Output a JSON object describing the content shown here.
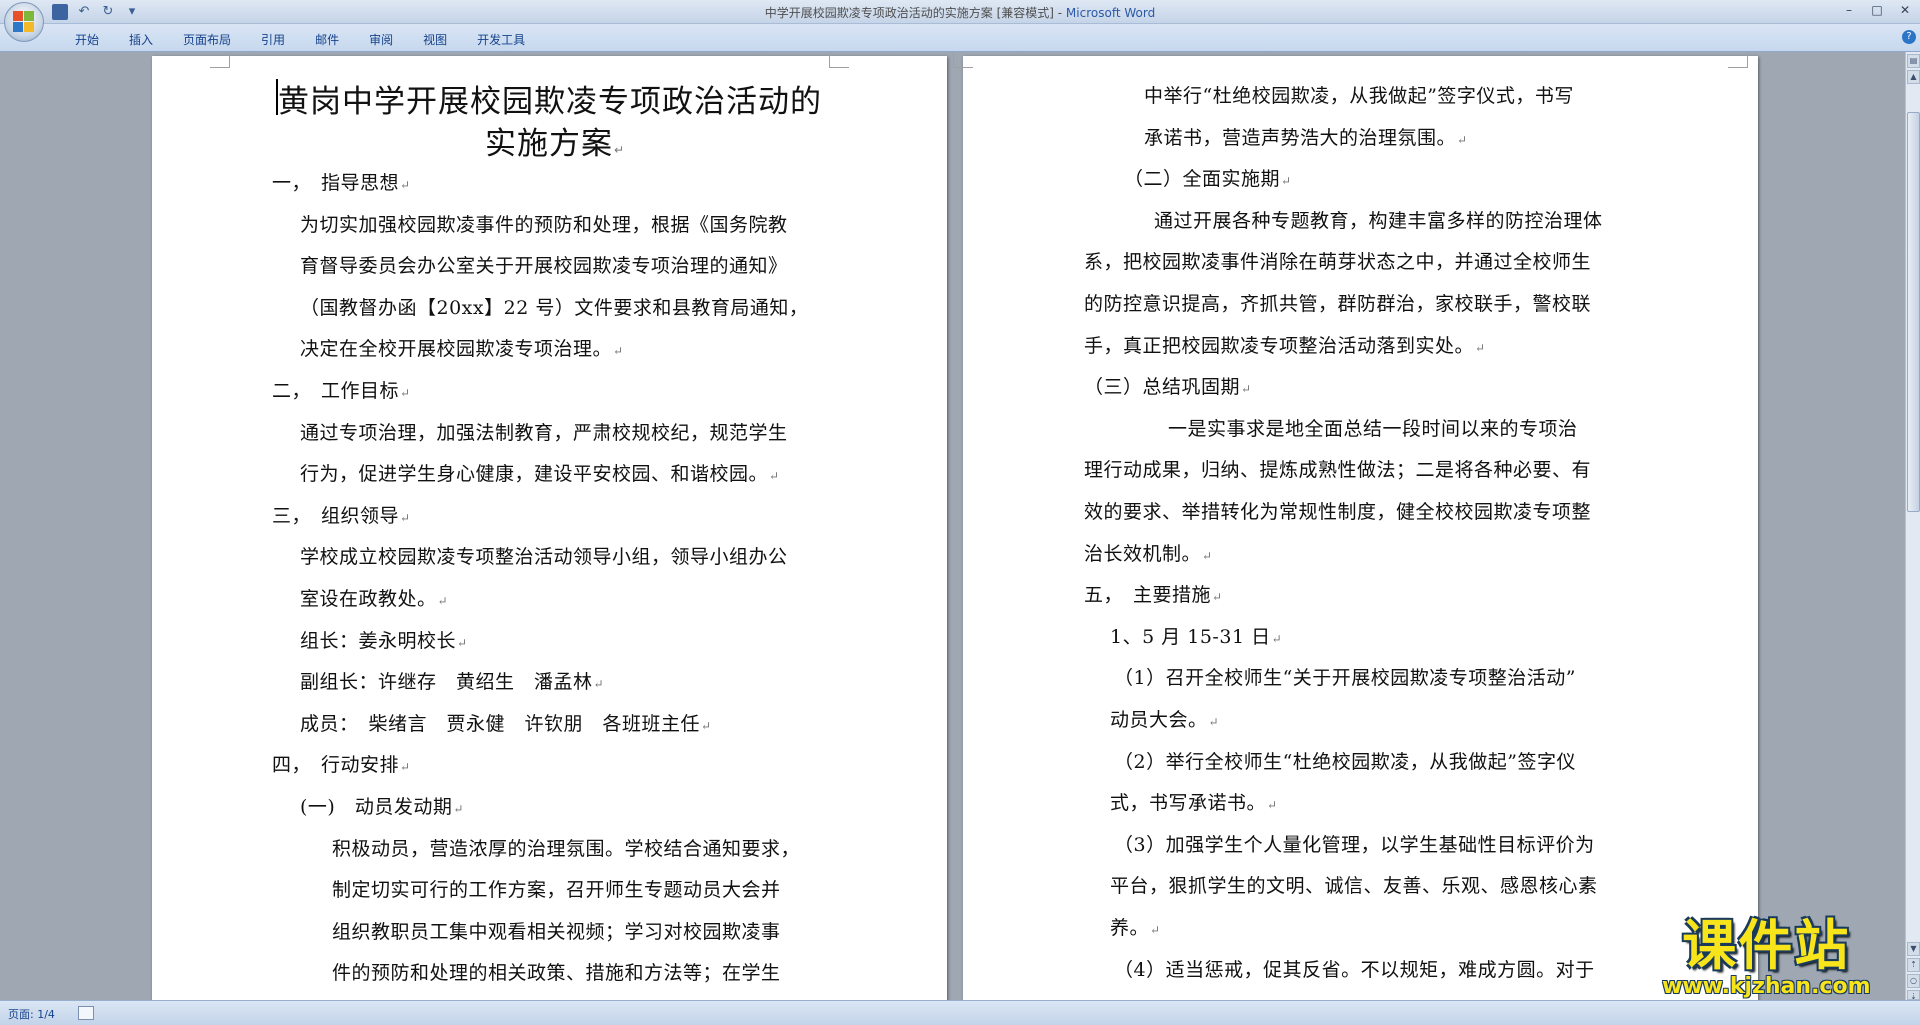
{
  "window": {
    "title": "中学开展校园欺凌专项政治活动的实施方案 [兼容模式] - ",
    "app_name": "Microsoft Word"
  },
  "quick_access": {
    "save_icon": "save-icon",
    "undo_icon": "undo-icon",
    "redo_icon": "redo-icon",
    "customize_icon": "dropdown-icon"
  },
  "ribbon": {
    "tabs": [
      "开始",
      "插入",
      "页面布局",
      "引用",
      "邮件",
      "审阅",
      "视图",
      "开发工具"
    ],
    "help": "?"
  },
  "page1": {
    "title_line1": "黄岗中学开展校园欺凌专项政治活动的",
    "title_line2": "实施方案",
    "lines": [
      "一，　指导思想",
      "为切实加强校园欺凌事件的预防和处理，根据《国务院教",
      "育督导委员会办公室关于开展校园欺凌专项治理的通知》",
      "（国教督办函【20xx】22 号）文件要求和县教育局通知，",
      "决定在全校开展校园欺凌专项治理。",
      "二，　工作目标",
      "通过专项治理，加强法制教育，严肃校规校纪，规范学生",
      "行为，促进学生身心健康，建设平安校园、和谐校园。",
      "三，　组织领导",
      "学校成立校园欺凌专项整治活动领导小组，领导小组办公",
      "室设在政教处。",
      "组长：姜永明校长",
      "副组长：许继存　黄绍生　潘孟林",
      "成员：　柴绪言　贾永健　许钦朋　各班班主任",
      "四，　行动安排",
      "(一)　动员发动期",
      "积极动员，营造浓厚的治理氛围。学校结合通知要求，",
      "制定切实可行的工作方案，召开师生专题动员大会并",
      "组织教职员工集中观看相关视频；学习对校园欺凌事",
      "件的预防和处理的相关政策、措施和方法等；在学生"
    ]
  },
  "page2": {
    "lines": [
      "中举行“杜绝校园欺凌，从我做起”签字仪式，书写",
      "承诺书，营造声势浩大的治理氛围。",
      "（二）全面实施期",
      "通过开展各种专题教育，构建丰富多样的防控治理体",
      "系，把校园欺凌事件消除在萌芽状态之中，并通过全校师生",
      "的防控意识提高，齐抓共管，群防群治，家校联手，警校联",
      "手，真正把校园欺凌专项整治活动落到实处。",
      "（三）总结巩固期",
      "一是实事求是地全面总结一段时间以来的专项治",
      "理行动成果，归纳、提炼成熟性做法；二是将各种必要、有",
      "效的要求、举措转化为常规性制度，健全校校园欺凌专项整",
      "治长效机制。",
      "五，　主要措施",
      "1、5 月 15-31 日",
      "（1）召开全校师生“关于开展校园欺凌专项整治活动”",
      "动员大会。",
      "（2）举行全校师生“杜绝校园欺凌，从我做起”签字仪",
      "式，书写承诺书。",
      "（3）加强学生个人量化管理，以学生基础性目标评价为",
      "平台，狠抓学生的文明、诚信、友善、乐观、感恩核心素",
      "养。",
      "（4）适当惩戒，促其反省。不以规矩，难成方圆。对于"
    ]
  },
  "paragraph_mark": "↵",
  "status": {
    "page": "页面: 1/4"
  },
  "watermark": {
    "main": "课件站",
    "url": "www.kjzhan.com"
  }
}
